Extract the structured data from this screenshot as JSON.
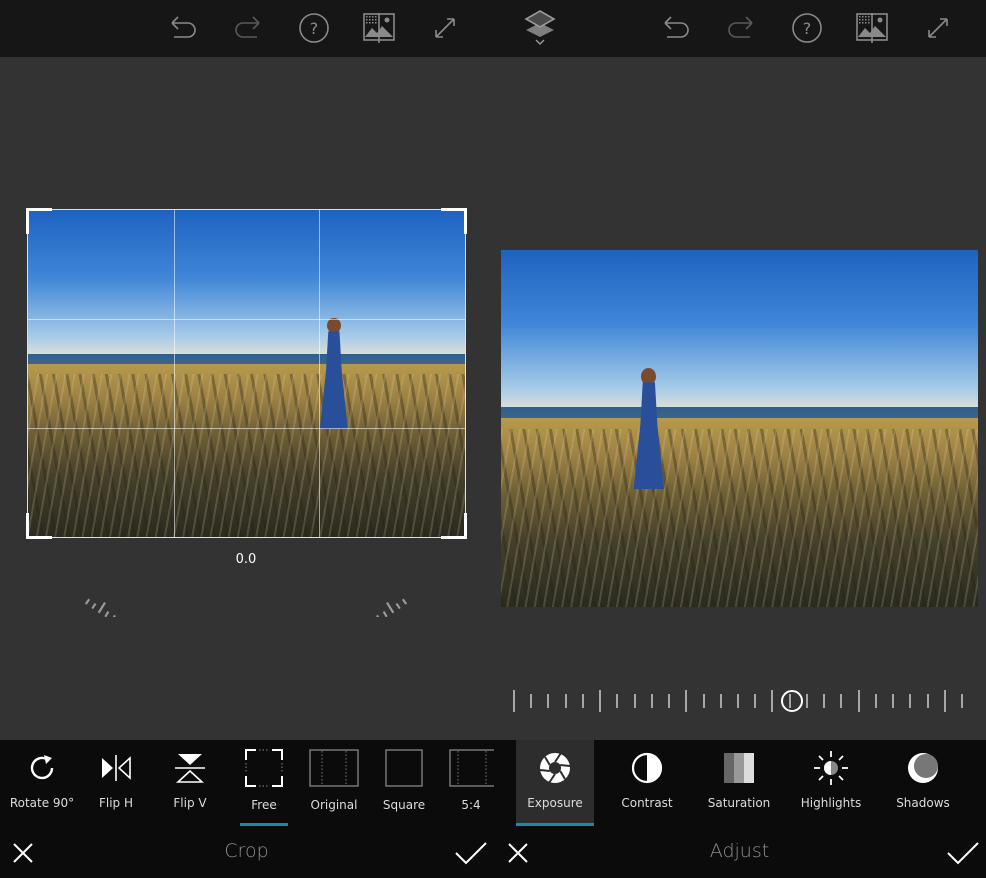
{
  "left_screen": {
    "toolbar": {
      "icons": [
        "undo-icon",
        "redo-icon",
        "help-icon",
        "before-after-icon",
        "fullscreen-icon"
      ]
    },
    "straighten_dial": {
      "value_label": "0.0",
      "angle_degrees": 0.0
    },
    "crop_tools": [
      {
        "label": "Rotate 90°",
        "icon": "rotate-icon"
      },
      {
        "label": "Flip H",
        "icon": "flip-horizontal-icon"
      },
      {
        "label": "Flip V",
        "icon": "flip-vertical-icon"
      },
      {
        "label": "Free",
        "icon": "free-crop-icon",
        "active": true
      },
      {
        "label": "Original",
        "icon": "original-ratio-icon"
      },
      {
        "label": "Square",
        "icon": "square-ratio-icon"
      },
      {
        "label": "5:4",
        "icon": "ratio-5-4-icon"
      }
    ],
    "footer": {
      "title": "Crop",
      "cancel_icon": "close-icon",
      "confirm_icon": "checkmark-icon"
    }
  },
  "right_screen": {
    "toolbar": {
      "icons": [
        "layers-icon",
        "undo-icon",
        "redo-icon",
        "help-icon",
        "before-after-icon",
        "fullscreen-icon"
      ]
    },
    "exposure_slider": {
      "value_fraction": 0.62
    },
    "adjust_tools": [
      {
        "label": "Exposure",
        "icon": "aperture-icon",
        "active": true
      },
      {
        "label": "Contrast",
        "icon": "contrast-icon"
      },
      {
        "label": "Saturation",
        "icon": "saturation-icon"
      },
      {
        "label": "Highlights",
        "icon": "sun-icon"
      },
      {
        "label": "Shadows",
        "icon": "moon-icon"
      }
    ],
    "footer": {
      "title": "Adjust",
      "cancel_icon": "close-icon",
      "confirm_icon": "checkmark-icon"
    }
  },
  "colors": {
    "accent": "#1a8ba0",
    "toolbar_bg": "#161616",
    "canvas_bg": "#333333",
    "bottom_bg": "#0b0b0b"
  }
}
